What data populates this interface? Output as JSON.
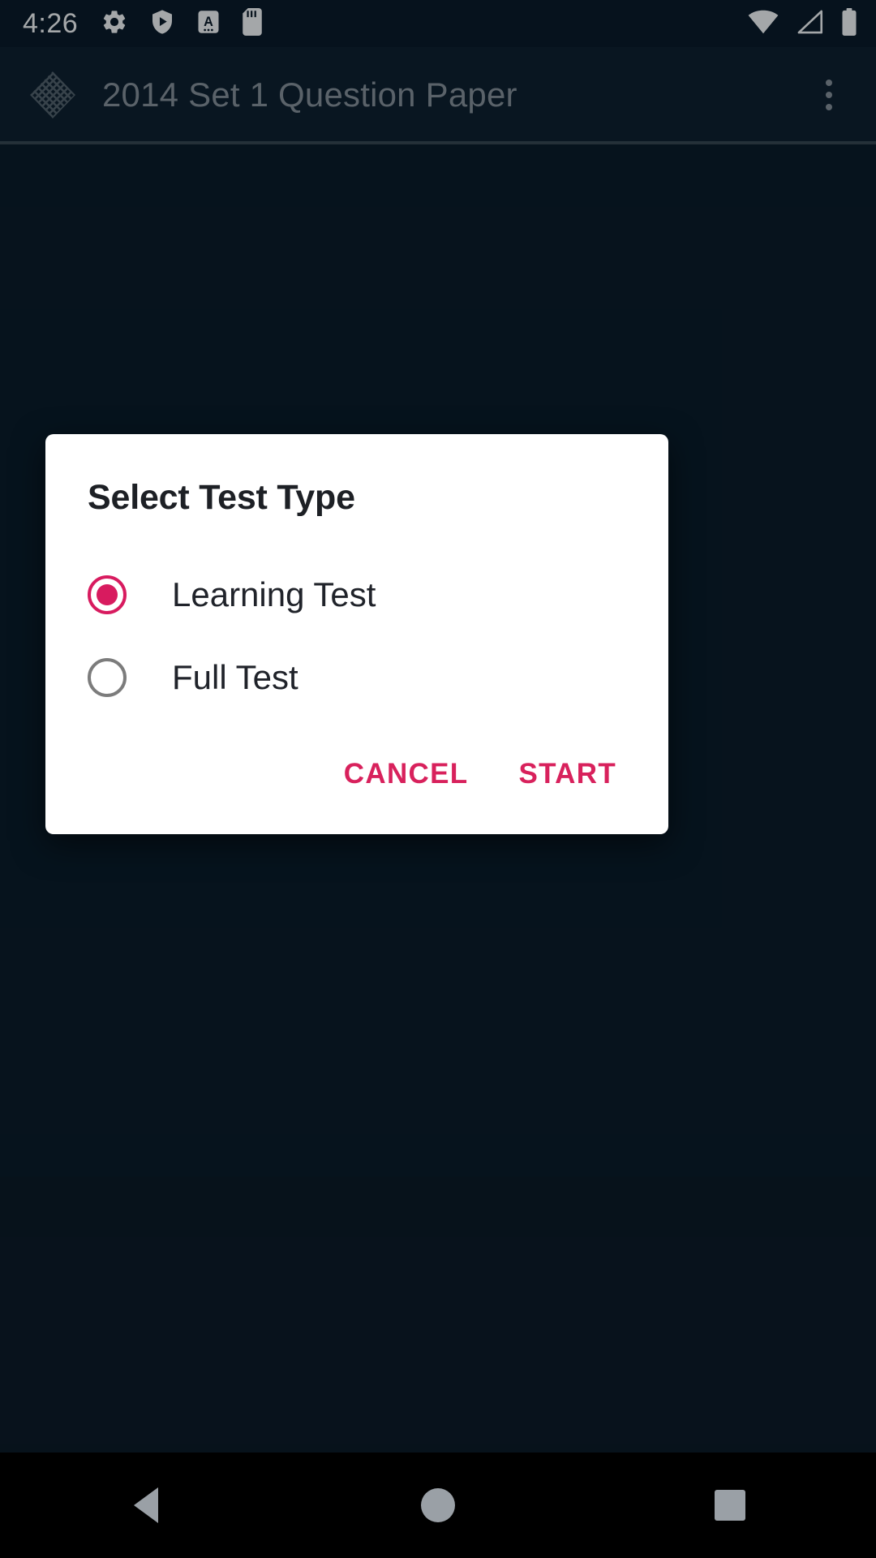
{
  "status_bar": {
    "time": "4:26",
    "left_icons": [
      {
        "name": "settings-gear-icon",
        "label": "Settings"
      },
      {
        "name": "play-protect-shield-icon",
        "label": "Play Protect"
      },
      {
        "name": "keyboard-input-method-icon",
        "label": "Input method A"
      },
      {
        "name": "sd-card-icon",
        "label": "SD card"
      }
    ],
    "right_icons": [
      {
        "name": "wifi-icon",
        "label": "Wi-Fi full signal"
      },
      {
        "name": "cellular-signal-icon",
        "label": "Mobile signal no bars"
      },
      {
        "name": "battery-icon",
        "label": "Battery full"
      }
    ]
  },
  "app_bar": {
    "logo_name": "app-logo-diamond-lattice",
    "title": "2014 Set 1 Question Paper",
    "overflow_label": "More options"
  },
  "dialog": {
    "title": "Select Test Type",
    "options": [
      {
        "label": "Learning Test",
        "selected": true
      },
      {
        "label": "Full Test",
        "selected": false
      }
    ],
    "actions": {
      "cancel_label": "CANCEL",
      "start_label": "START"
    }
  },
  "nav_bar": {
    "back_label": "Back",
    "home_label": "Home",
    "recents_label": "Recents"
  },
  "colors": {
    "accent": "#d81b5f",
    "action_text": "#d8215c",
    "status_bar_bg": "#091724",
    "app_bar_bg": "#0d1d2b",
    "content_bg": "#091824",
    "dialog_bg": "#ffffff",
    "title_text": "#8b949c",
    "nav_bar_bg": "#000000",
    "nav_icon": "#9aa0a6"
  }
}
